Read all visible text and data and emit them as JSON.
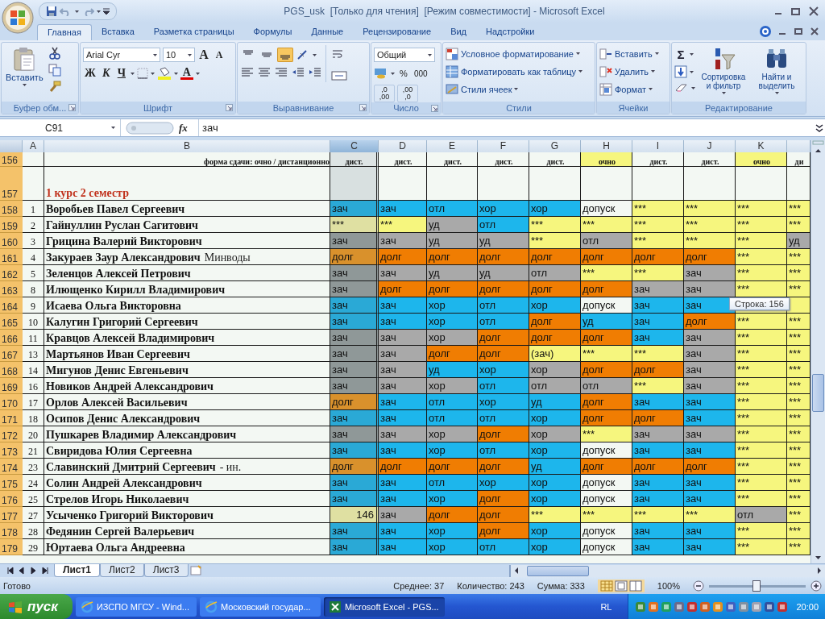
{
  "window": {
    "title": "PGS_usk  [Только для чтения]  [Режим совместимости] - Microsoft Excel"
  },
  "ribbon_tabs": [
    {
      "label": "Главная",
      "selected": true
    },
    {
      "label": "Вставка",
      "selected": false
    },
    {
      "label": "Разметка страницы",
      "selected": false
    },
    {
      "label": "Формулы",
      "selected": false
    },
    {
      "label": "Данные",
      "selected": false
    },
    {
      "label": "Рецензирование",
      "selected": false
    },
    {
      "label": "Вид",
      "selected": false
    },
    {
      "label": "Надстройки",
      "selected": false
    }
  ],
  "clipboard": {
    "label": "Буфер обм...",
    "paste": "Вставить"
  },
  "font": {
    "label": "Шрифт",
    "family": "Arial Cyr",
    "size": "10",
    "grow": "A",
    "shrink": "A",
    "bold": "Ж",
    "italic": "К",
    "underline": "Ч",
    "color_button": "A"
  },
  "alignment": {
    "label": "Выравнивание",
    "vertical_buttons": [
      {
        "selected": false
      },
      {
        "selected": false
      },
      {
        "selected": true
      }
    ]
  },
  "number": {
    "label": "Число",
    "format": "Общий",
    "percent": "%",
    "thousands": "000",
    "decimals": [
      ",0 ,00",
      ",00 ,0"
    ]
  },
  "styles": {
    "label": "Стили",
    "items": [
      "Условное форматирование",
      "Форматировать как таблицу",
      "Стили ячеек"
    ]
  },
  "cells_group": {
    "label": "Ячейки",
    "items": [
      "Вставить",
      "Удалить",
      "Формат"
    ]
  },
  "editing": {
    "label": "Редактирование",
    "sum": "Σ",
    "sort": "Сортировка и фильтр",
    "find": "Найти и выделить"
  },
  "formula_bar": {
    "name_box": "C91",
    "fx": "fx",
    "formula": "зач"
  },
  "columns": [
    {
      "label": "A",
      "selected": false
    },
    {
      "label": "B",
      "selected": false
    },
    {
      "label": "C",
      "selected": true
    },
    {
      "label": "D",
      "selected": false
    },
    {
      "label": "E",
      "selected": false
    },
    {
      "label": "F",
      "selected": false
    },
    {
      "label": "G",
      "selected": false
    },
    {
      "label": "H",
      "selected": false
    },
    {
      "label": "I",
      "selected": false
    },
    {
      "label": "J",
      "selected": false
    },
    {
      "label": "K",
      "selected": false
    }
  ],
  "rows": [
    {
      "header": "156",
      "kind": "form",
      "name": "форма сдачи: очно / дистанционно",
      "cells": [
        {
          "text": "дист.",
          "color": "#dde4e4"
        },
        {
          "text": "дист.",
          "color": "#f3f8f3"
        },
        {
          "text": "дист.",
          "color": "#f3f8f3"
        },
        {
          "text": "дист.",
          "color": "#f3f8f3"
        },
        {
          "text": "дист.",
          "color": "#f3f8f3"
        },
        {
          "text": "очно",
          "color": "#f6f67e"
        },
        {
          "text": "дист.",
          "color": "#f3f8f3"
        },
        {
          "text": "дист.",
          "color": "#f3f8f3"
        },
        {
          "text": "очно",
          "color": "#f6f67e"
        },
        {
          "text": "ди",
          "color": "#f3f8f3"
        }
      ]
    },
    {
      "header": "157",
      "kind": "title",
      "name": "1 курс 2 семестр",
      "cells": [
        {
          "color": "#d8e0e0"
        },
        {
          "color": "#f3f8f3"
        },
        {
          "color": "#f3f8f3"
        },
        {
          "color": "#f3f8f3"
        },
        {
          "color": "#f3f8f3"
        },
        {
          "color": "#f3f8f3"
        },
        {
          "color": "#f3f8f3"
        },
        {
          "color": "#f3f8f3"
        },
        {
          "color": "#f3f8f3"
        },
        {
          "color": "#f3f8f3"
        }
      ]
    },
    {
      "header": "158",
      "kind": "student",
      "num": "1",
      "name": "Воробьев Павел Сергеевич",
      "cells": [
        {
          "text": "зач",
          "color": "#2aa9d6"
        },
        {
          "text": "зач",
          "color": "#1db6ec"
        },
        {
          "text": "отл",
          "color": "#1db6ec"
        },
        {
          "text": "хор",
          "color": "#1db6ec"
        },
        {
          "text": "хор",
          "color": "#1db6ec"
        },
        {
          "text": "допуск",
          "color": "#f3f8f3"
        },
        {
          "text": "***",
          "color": "#f6f67e"
        },
        {
          "text": "***",
          "color": "#f6f67e"
        },
        {
          "text": "***",
          "color": "#f6f67e"
        },
        {
          "text": "***",
          "color": "#f6f67e"
        }
      ]
    },
    {
      "header": "159",
      "kind": "student",
      "num": "2",
      "name": "Гайнуллин Руслан Сагитович",
      "cells": [
        {
          "text": "***",
          "color": "#dfe0a2"
        },
        {
          "text": "***",
          "color": "#f6f67e"
        },
        {
          "text": "уд",
          "color": "#a9a9a9"
        },
        {
          "text": "отл",
          "color": "#1db6ec"
        },
        {
          "text": "***",
          "color": "#f6f67e"
        },
        {
          "text": "***",
          "color": "#f6f67e"
        },
        {
          "text": "***",
          "color": "#f6f67e"
        },
        {
          "text": "***",
          "color": "#f6f67e"
        },
        {
          "text": "***",
          "color": "#f6f67e"
        },
        {
          "text": "***",
          "color": "#f6f67e"
        }
      ]
    },
    {
      "header": "160",
      "kind": "student",
      "num": "3",
      "name": "Грицина Валерий Викторович",
      "cells": [
        {
          "text": "зач",
          "color": "#8f9898"
        },
        {
          "text": "зач",
          "color": "#a9a9a9"
        },
        {
          "text": "уд",
          "color": "#a9a9a9"
        },
        {
          "text": "уд",
          "color": "#a9a9a9"
        },
        {
          "text": "***",
          "color": "#f6f67e"
        },
        {
          "text": "отл",
          "color": "#a9a9a9"
        },
        {
          "text": "***",
          "color": "#f6f67e"
        },
        {
          "text": "***",
          "color": "#f6f67e"
        },
        {
          "text": "***",
          "color": "#f6f67e"
        },
        {
          "text": "уд",
          "color": "#a9a9a9"
        }
      ]
    },
    {
      "header": "161",
      "kind": "student",
      "num": "4",
      "name": "Закураев Заур Александрович",
      "note": "Минводы",
      "cells": [
        {
          "text": "долг",
          "color": "#d9912c"
        },
        {
          "text": "долг",
          "color": "#f07d02"
        },
        {
          "text": "долг",
          "color": "#f07d02"
        },
        {
          "text": "долг",
          "color": "#f07d02"
        },
        {
          "text": "долг",
          "color": "#f07d02"
        },
        {
          "text": "долг",
          "color": "#f07d02"
        },
        {
          "text": "долг",
          "color": "#f07d02"
        },
        {
          "text": "долг",
          "color": "#f07d02"
        },
        {
          "text": "***",
          "color": "#f6f67e"
        },
        {
          "text": "***",
          "color": "#f6f67e"
        }
      ]
    },
    {
      "header": "162",
      "kind": "student",
      "num": "5",
      "name": "Зеленцов Алексей Петрович",
      "cells": [
        {
          "text": "зач",
          "color": "#8f9898"
        },
        {
          "text": "зач",
          "color": "#a9a9a9"
        },
        {
          "text": "уд",
          "color": "#a9a9a9"
        },
        {
          "text": "уд",
          "color": "#a9a9a9"
        },
        {
          "text": "отл",
          "color": "#a9a9a9"
        },
        {
          "text": "***",
          "color": "#f6f67e"
        },
        {
          "text": "***",
          "color": "#f6f67e"
        },
        {
          "text": "зач",
          "color": "#a9a9a9"
        },
        {
          "text": "***",
          "color": "#f6f67e"
        },
        {
          "text": "***",
          "color": "#f6f67e"
        }
      ]
    },
    {
      "header": "163",
      "kind": "student",
      "num": "8",
      "name": "Илющенко Кирилл Владимирович",
      "cells": [
        {
          "text": "зач",
          "color": "#8f9898"
        },
        {
          "text": "долг",
          "color": "#f07d02"
        },
        {
          "text": "долг",
          "color": "#f07d02"
        },
        {
          "text": "долг",
          "color": "#f07d02"
        },
        {
          "text": "долг",
          "color": "#f07d02"
        },
        {
          "text": "долг",
          "color": "#f07d02"
        },
        {
          "text": "зач",
          "color": "#a9a9a9"
        },
        {
          "text": "зач",
          "color": "#a9a9a9"
        },
        {
          "text": "***",
          "color": "#f6f67e"
        },
        {
          "text": "***",
          "color": "#f6f67e"
        }
      ]
    },
    {
      "header": "164",
      "kind": "student",
      "num": "9",
      "name": "Исаева Ольга Викторовна",
      "cells": [
        {
          "text": "зач",
          "color": "#2aa9d6"
        },
        {
          "text": "зач",
          "color": "#1db6ec"
        },
        {
          "text": "хор",
          "color": "#1db6ec"
        },
        {
          "text": "отл",
          "color": "#1db6ec"
        },
        {
          "text": "хор",
          "color": "#1db6ec"
        },
        {
          "text": "допуск",
          "color": "#f3f8f3"
        },
        {
          "text": "зач",
          "color": "#1db6ec"
        },
        {
          "text": "зач",
          "color": "#1db6ec"
        },
        {
          "color": "#f6f67e"
        },
        {
          "color": "#f6f67e"
        }
      ]
    },
    {
      "header": "165",
      "kind": "student",
      "num": "10",
      "name": "Калугин Григорий Сергеевич",
      "cells": [
        {
          "text": "зач",
          "color": "#2aa9d6"
        },
        {
          "text": "зач",
          "color": "#1db6ec"
        },
        {
          "text": "хор",
          "color": "#1db6ec"
        },
        {
          "text": "отл",
          "color": "#1db6ec"
        },
        {
          "text": "долг",
          "color": "#f07d02"
        },
        {
          "text": "уд",
          "color": "#1db6ec"
        },
        {
          "text": "зач",
          "color": "#1db6ec"
        },
        {
          "text": "долг",
          "color": "#f07d02"
        },
        {
          "text": "***",
          "color": "#f6f67e"
        },
        {
          "text": "***",
          "color": "#f6f67e"
        }
      ]
    },
    {
      "header": "166",
      "kind": "student",
      "num": "11",
      "name": "Кравцов Алексей Владимирович",
      "cells": [
        {
          "text": "зач",
          "color": "#8f9898"
        },
        {
          "text": "зач",
          "color": "#a9a9a9"
        },
        {
          "text": "хор",
          "color": "#a9a9a9"
        },
        {
          "text": "долг",
          "color": "#f07d02"
        },
        {
          "text": "долг",
          "color": "#f07d02"
        },
        {
          "text": "долг",
          "color": "#f07d02"
        },
        {
          "text": "зач",
          "color": "#1db6ec"
        },
        {
          "text": "зач",
          "color": "#a9a9a9"
        },
        {
          "text": "***",
          "color": "#f6f67e"
        },
        {
          "text": "***",
          "color": "#f6f67e"
        }
      ]
    },
    {
      "header": "167",
      "kind": "student",
      "num": "13",
      "name": "Мартьянов Иван Сергеевич",
      "cells": [
        {
          "text": "зач",
          "color": "#8f9898"
        },
        {
          "text": "зач",
          "color": "#a9a9a9"
        },
        {
          "text": "долг",
          "color": "#f07d02"
        },
        {
          "text": "долг",
          "color": "#f07d02"
        },
        {
          "text": "(зач)",
          "color": "#f6f67e"
        },
        {
          "text": "***",
          "color": "#f6f67e"
        },
        {
          "text": "***",
          "color": "#f6f67e"
        },
        {
          "text": "зач",
          "color": "#a9a9a9"
        },
        {
          "text": "***",
          "color": "#f6f67e"
        },
        {
          "text": "***",
          "color": "#f6f67e"
        }
      ]
    },
    {
      "header": "168",
      "kind": "student",
      "num": "14",
      "name": "Мигунов Денис Евгеньевич",
      "cells": [
        {
          "text": "зач",
          "color": "#8f9898"
        },
        {
          "text": "зач",
          "color": "#a9a9a9"
        },
        {
          "text": "уд",
          "color": "#1db6ec"
        },
        {
          "text": "хор",
          "color": "#1db6ec"
        },
        {
          "text": "хор",
          "color": "#a9a9a9"
        },
        {
          "text": "долг",
          "color": "#f07d02"
        },
        {
          "text": "долг",
          "color": "#f07d02"
        },
        {
          "text": "зач",
          "color": "#a9a9a9"
        },
        {
          "text": "***",
          "color": "#f6f67e"
        },
        {
          "text": "***",
          "color": "#f6f67e"
        }
      ]
    },
    {
      "header": "169",
      "kind": "student",
      "num": "16",
      "name": "Новиков Андрей Александрович",
      "cells": [
        {
          "text": "зач",
          "color": "#8f9898"
        },
        {
          "text": "зач",
          "color": "#a9a9a9"
        },
        {
          "text": "хор",
          "color": "#a9a9a9"
        },
        {
          "text": "отл",
          "color": "#1db6ec"
        },
        {
          "text": "отл",
          "color": "#a9a9a9"
        },
        {
          "text": "отл",
          "color": "#a9a9a9"
        },
        {
          "text": "***",
          "color": "#f6f67e"
        },
        {
          "text": "зач",
          "color": "#a9a9a9"
        },
        {
          "text": "***",
          "color": "#f6f67e"
        },
        {
          "text": "***",
          "color": "#f6f67e"
        }
      ]
    },
    {
      "header": "170",
      "kind": "student",
      "num": "17",
      "name": "Орлов Алексей Васильевич",
      "cells": [
        {
          "text": "долг",
          "color": "#d9912c"
        },
        {
          "text": "зач",
          "color": "#1db6ec"
        },
        {
          "text": "отл",
          "color": "#1db6ec"
        },
        {
          "text": "хор",
          "color": "#1db6ec"
        },
        {
          "text": "уд",
          "color": "#1db6ec"
        },
        {
          "text": "долг",
          "color": "#f07d02"
        },
        {
          "text": "зач",
          "color": "#1db6ec"
        },
        {
          "text": "зач",
          "color": "#1db6ec"
        },
        {
          "text": "***",
          "color": "#f6f67e"
        },
        {
          "text": "***",
          "color": "#f6f67e"
        }
      ]
    },
    {
      "header": "171",
      "kind": "student",
      "num": "18",
      "name": "Осипов Денис Александрович",
      "cells": [
        {
          "text": "зач",
          "color": "#2aa9d6"
        },
        {
          "text": "зач",
          "color": "#1db6ec"
        },
        {
          "text": "отл",
          "color": "#1db6ec"
        },
        {
          "text": "отл",
          "color": "#1db6ec"
        },
        {
          "text": "хор",
          "color": "#1db6ec"
        },
        {
          "text": "долг",
          "color": "#f07d02"
        },
        {
          "text": "долг",
          "color": "#f07d02"
        },
        {
          "text": "зач",
          "color": "#1db6ec"
        },
        {
          "text": "***",
          "color": "#f6f67e"
        },
        {
          "text": "***",
          "color": "#f6f67e"
        }
      ]
    },
    {
      "header": "172",
      "kind": "student",
      "num": "20",
      "name": "Пушкарев Владимир Александрович",
      "cells": [
        {
          "text": "зач",
          "color": "#8f9898"
        },
        {
          "text": "зач",
          "color": "#a9a9a9"
        },
        {
          "text": "хор",
          "color": "#a9a9a9"
        },
        {
          "text": "долг",
          "color": "#f07d02"
        },
        {
          "text": "хор",
          "color": "#a9a9a9"
        },
        {
          "text": "***",
          "color": "#f6f67e"
        },
        {
          "text": "зач",
          "color": "#a9a9a9"
        },
        {
          "text": "зач",
          "color": "#a9a9a9"
        },
        {
          "text": "***",
          "color": "#f6f67e"
        },
        {
          "text": "***",
          "color": "#f6f67e"
        }
      ]
    },
    {
      "header": "173",
      "kind": "student",
      "num": "21",
      "name": "Свиридова Юлия Сергеевна",
      "cells": [
        {
          "text": "зач",
          "color": "#2aa9d6"
        },
        {
          "text": "зач",
          "color": "#1db6ec"
        },
        {
          "text": "хор",
          "color": "#1db6ec"
        },
        {
          "text": "отл",
          "color": "#1db6ec"
        },
        {
          "text": "хор",
          "color": "#1db6ec"
        },
        {
          "text": "допуск",
          "color": "#f3f8f3"
        },
        {
          "text": "зач",
          "color": "#1db6ec"
        },
        {
          "text": "зач",
          "color": "#1db6ec"
        },
        {
          "text": "***",
          "color": "#f6f67e"
        },
        {
          "text": "***",
          "color": "#f6f67e"
        }
      ]
    },
    {
      "header": "174",
      "kind": "student",
      "num": "23",
      "name": "Славинский Дмитрий Сергеевич",
      "note": "- ин.",
      "cells": [
        {
          "text": "долг",
          "color": "#d9912c"
        },
        {
          "text": "долг",
          "color": "#f07d02"
        },
        {
          "text": "долг",
          "color": "#f07d02"
        },
        {
          "text": "долг",
          "color": "#f07d02"
        },
        {
          "text": "уд",
          "color": "#1db6ec"
        },
        {
          "text": "долг",
          "color": "#f07d02"
        },
        {
          "text": "долг",
          "color": "#f07d02"
        },
        {
          "text": "долг",
          "color": "#f07d02"
        },
        {
          "text": "***",
          "color": "#f6f67e"
        },
        {
          "text": "***",
          "color": "#f6f67e"
        }
      ]
    },
    {
      "header": "175",
      "kind": "student",
      "num": "24",
      "name": "Солин Андрей Александрович",
      "cells": [
        {
          "text": "зач",
          "color": "#2aa9d6"
        },
        {
          "text": "зач",
          "color": "#1db6ec"
        },
        {
          "text": "отл",
          "color": "#1db6ec"
        },
        {
          "text": "хор",
          "color": "#1db6ec"
        },
        {
          "text": "хор",
          "color": "#1db6ec"
        },
        {
          "text": "допуск",
          "color": "#f3f8f3"
        },
        {
          "text": "зач",
          "color": "#1db6ec"
        },
        {
          "text": "зач",
          "color": "#1db6ec"
        },
        {
          "text": "***",
          "color": "#f6f67e"
        },
        {
          "text": "***",
          "color": "#f6f67e"
        }
      ]
    },
    {
      "header": "176",
      "kind": "student",
      "num": "25",
      "name": "Стрелов Игорь Николаевич",
      "cells": [
        {
          "text": "зач",
          "color": "#2aa9d6"
        },
        {
          "text": "зач",
          "color": "#1db6ec"
        },
        {
          "text": "хор",
          "color": "#1db6ec"
        },
        {
          "text": "долг",
          "color": "#f07d02"
        },
        {
          "text": "хор",
          "color": "#1db6ec"
        },
        {
          "text": "допуск",
          "color": "#f3f8f3"
        },
        {
          "text": "зач",
          "color": "#1db6ec"
        },
        {
          "text": "зач",
          "color": "#1db6ec"
        },
        {
          "text": "***",
          "color": "#f6f67e"
        },
        {
          "text": "***",
          "color": "#f6f67e"
        }
      ]
    },
    {
      "header": "177",
      "kind": "student",
      "num": "27",
      "name": "Усыченко Григорий Викторович",
      "cells": [
        {
          "text": "146",
          "color": "#dfe0a2",
          "kind": "number"
        },
        {
          "text": "зач",
          "color": "#a9a9a9"
        },
        {
          "text": "долг",
          "color": "#f07d02"
        },
        {
          "text": "долг",
          "color": "#f07d02"
        },
        {
          "text": "***",
          "color": "#f6f67e"
        },
        {
          "text": "***",
          "color": "#f6f67e"
        },
        {
          "text": "***",
          "color": "#f6f67e"
        },
        {
          "text": "***",
          "color": "#f6f67e"
        },
        {
          "text": "отл",
          "color": "#a9a9a9"
        },
        {
          "text": "***",
          "color": "#f6f67e"
        }
      ]
    },
    {
      "header": "178",
      "kind": "student",
      "num": "28",
      "name": "Федянин Сергей Валерьевич",
      "cells": [
        {
          "text": "зач",
          "color": "#2aa9d6"
        },
        {
          "text": "зач",
          "color": "#1db6ec"
        },
        {
          "text": "хор",
          "color": "#1db6ec"
        },
        {
          "text": "долг",
          "color": "#f07d02"
        },
        {
          "text": "хор",
          "color": "#1db6ec"
        },
        {
          "text": "допуск",
          "color": "#f3f8f3"
        },
        {
          "text": "зач",
          "color": "#1db6ec"
        },
        {
          "text": "зач",
          "color": "#1db6ec"
        },
        {
          "text": "***",
          "color": "#f6f67e"
        },
        {
          "text": "***",
          "color": "#f6f67e"
        }
      ]
    },
    {
      "header": "179",
      "kind": "student",
      "num": "29",
      "name": "Юртаева Ольга Андреевна",
      "cells": [
        {
          "text": "зач",
          "color": "#2aa9d6"
        },
        {
          "text": "зач",
          "color": "#1db6ec"
        },
        {
          "text": "хор",
          "color": "#1db6ec"
        },
        {
          "text": "отл",
          "color": "#1db6ec"
        },
        {
          "text": "хор",
          "color": "#1db6ec"
        },
        {
          "text": "допуск",
          "color": "#f3f8f3"
        },
        {
          "text": "зач",
          "color": "#1db6ec"
        },
        {
          "text": "зач",
          "color": "#1db6ec"
        },
        {
          "text": "***",
          "color": "#f6f67e"
        },
        {
          "text": "***",
          "color": "#f6f67e"
        }
      ]
    }
  ],
  "tooltip": "Строка: 156",
  "sheet_tabs": [
    {
      "label": "Лист1",
      "selected": true
    },
    {
      "label": "Лист2",
      "selected": false
    },
    {
      "label": "Лист3",
      "selected": false
    }
  ],
  "status_bar": {
    "ready": "Готово",
    "average": "Среднее: 37",
    "count": "Количество: 243",
    "sum": "Сумма: 333",
    "zoom": "100%",
    "zoom_slider": {
      "level": 0.5
    }
  },
  "taskbar": {
    "start": "пуск",
    "tasks": [
      {
        "label": "ИЗСПО МГСУ - Wind...",
        "selected": false
      },
      {
        "label": "Московский государ...",
        "selected": false
      },
      {
        "label": "Microsoft Excel - PGS...",
        "selected": true
      }
    ],
    "language": "RL",
    "clock": "20:00"
  }
}
